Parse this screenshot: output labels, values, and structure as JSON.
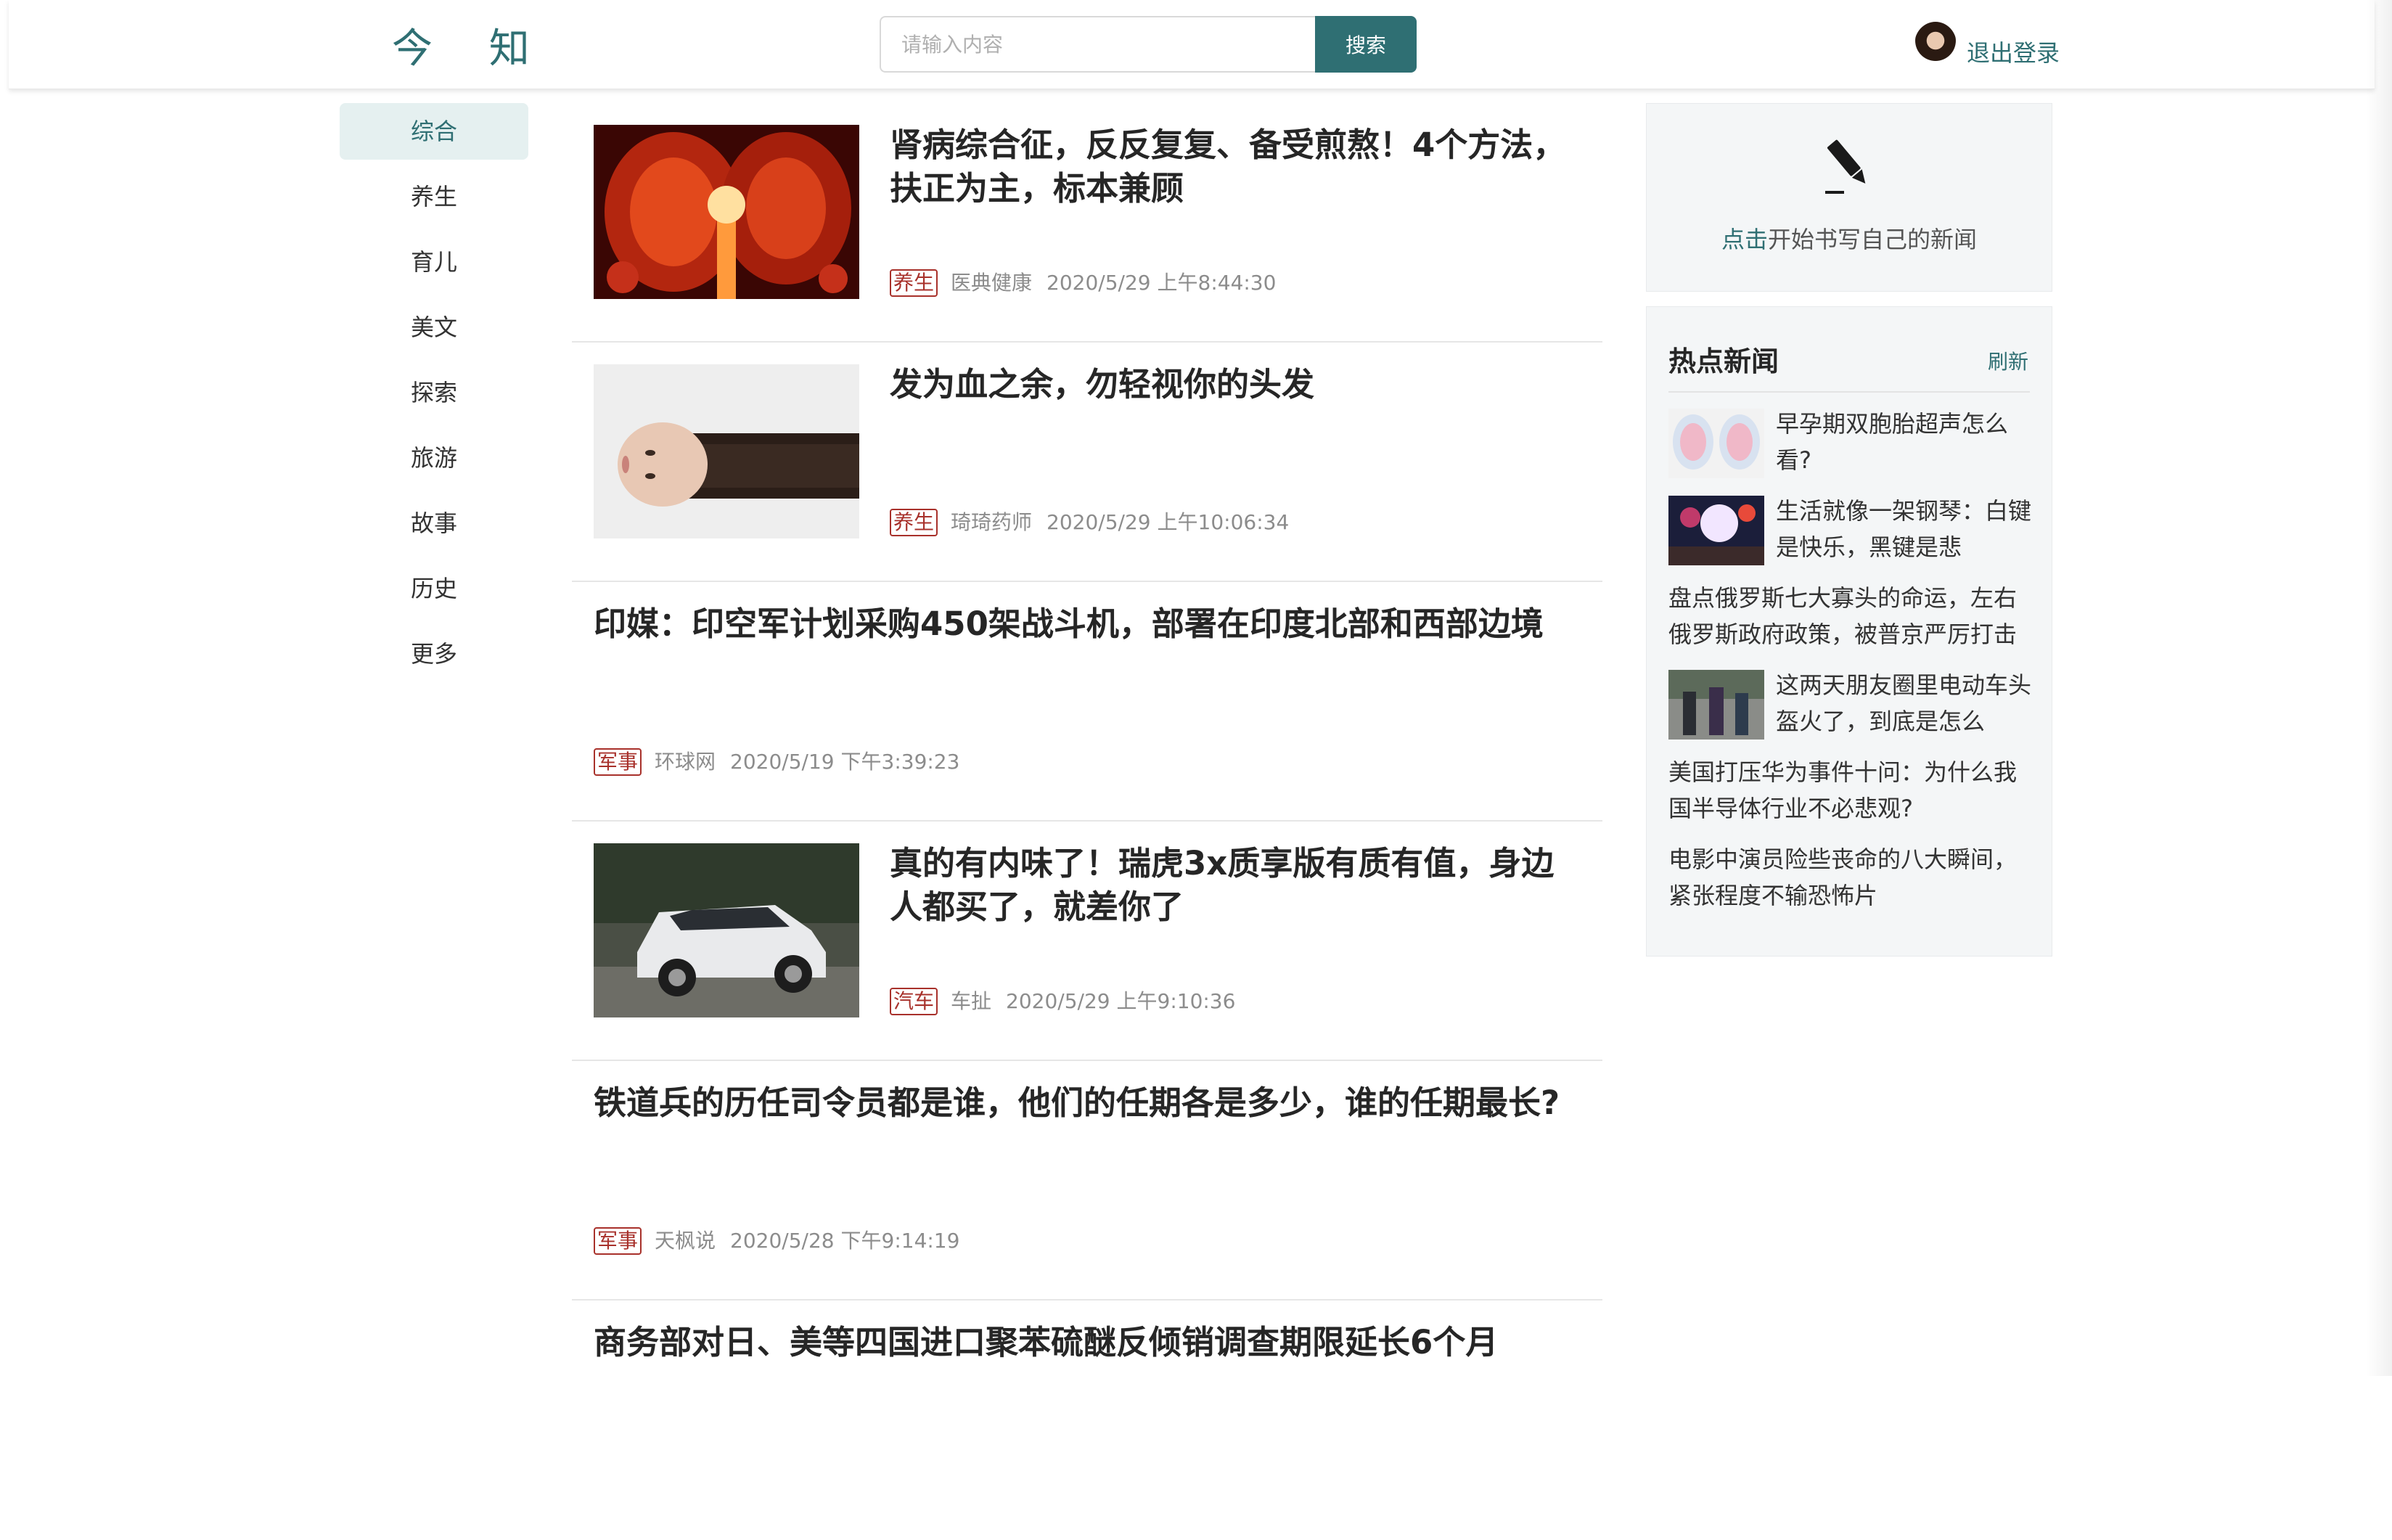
{
  "header": {
    "logo": "今 知",
    "search_placeholder": "请输入内容",
    "search_button": "搜索",
    "logout": "退出登录"
  },
  "nav": {
    "items": [
      {
        "label": "综合",
        "active": true
      },
      {
        "label": "养生"
      },
      {
        "label": "育儿"
      },
      {
        "label": "美文"
      },
      {
        "label": "探索"
      },
      {
        "label": "旅游"
      },
      {
        "label": "故事"
      },
      {
        "label": "历史"
      },
      {
        "label": "更多"
      }
    ]
  },
  "articles": [
    {
      "title": "肾病综合征，反反复复、备受煎熬！4个方法，扶正为主，标本兼顾",
      "tag": "养生",
      "source": "医典健康",
      "time": "2020/5/29 上午8:44:30",
      "image": "kidney-illustration"
    },
    {
      "title": "发为血之余，勿轻视你的头发",
      "tag": "养生",
      "source": "琦琦药师",
      "time": "2020/5/29 上午10:06:34",
      "image": "woman-long-hair"
    },
    {
      "title": "印媒：印空军计划采购450架战斗机，部署在印度北部和西部边境",
      "tag": "军事",
      "source": "环球网",
      "time": "2020/5/19 下午3:39:23"
    },
    {
      "title": "真的有内味了！瑞虎3x质享版有质有值，身边人都买了，就差你了",
      "tag": "汽车",
      "source": "车扯",
      "time": "2020/5/29 上午9:10:36",
      "image": "white-suv"
    },
    {
      "title": "铁道兵的历任司令员都是谁，他们的任期各是多少，谁的任期最长?",
      "tag": "军事",
      "source": "天枫说",
      "time": "2020/5/28 下午9:14:19"
    },
    {
      "title": "商务部对日、美等四国进口聚苯硫醚反倾销调查期限延长6个月"
    }
  ],
  "write": {
    "click": "点击",
    "text": "开始书写自己的新闻"
  },
  "hot": {
    "title": "热点新闻",
    "refresh": "刷新",
    "items": [
      {
        "text": "早孕期双胞胎超声怎么看?",
        "image": "ultrasound"
      },
      {
        "text": "生活就像一架钢琴：白键是快乐，黑键是悲",
        "image": "fireworks"
      },
      {
        "text": "盘点俄罗斯七大寡头的命运，左右俄罗斯政府政策，被普京严厉打击"
      },
      {
        "text": "这两天朋友圈里电动车头盔火了，到底是怎么",
        "image": "street-scene"
      },
      {
        "text": "美国打压华为事件十问：为什么我国半导体行业不必悲观?"
      },
      {
        "text": "电影中演员险些丧命的八大瞬间，紧张程度不输恐怖片"
      }
    ]
  },
  "colors": {
    "accent": "#2f6f73",
    "tag_red": "#a8312b"
  }
}
